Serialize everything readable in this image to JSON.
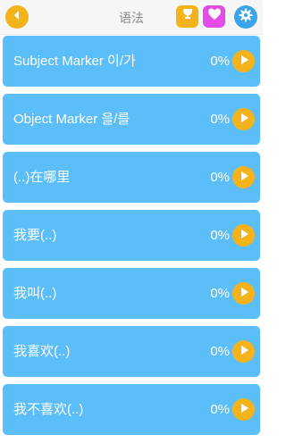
{
  "header": {
    "title": "语法"
  },
  "lessons": [
    {
      "label": "Subject Marker 이/가",
      "progress": "0%"
    },
    {
      "label": "Object Marker 을/를",
      "progress": "0%"
    },
    {
      "label": "(..)在哪里",
      "progress": "0%"
    },
    {
      "label": "我要(..)",
      "progress": "0%"
    },
    {
      "label": "我叫(..)",
      "progress": "0%"
    },
    {
      "label": "我喜欢(..)",
      "progress": "0%"
    },
    {
      "label": "我不喜欢(..)",
      "progress": "0%"
    }
  ],
  "colors": {
    "row": "#5bbef8",
    "accent": "#f5b31b",
    "heart": "#e24de8",
    "settings": "#3aa6e8"
  }
}
